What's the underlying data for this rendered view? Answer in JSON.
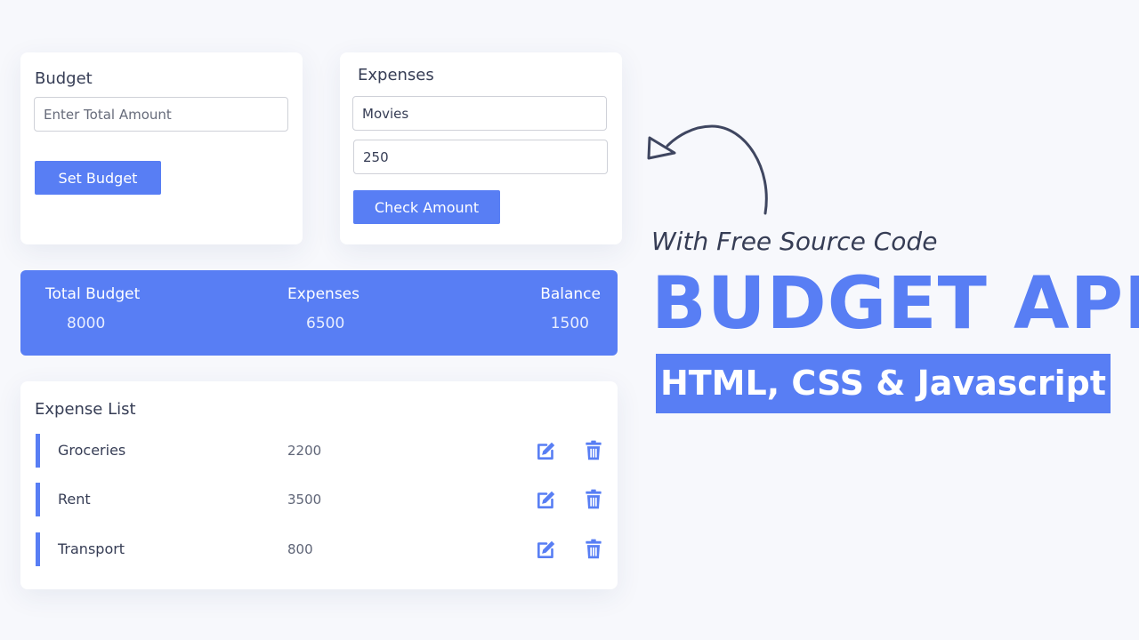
{
  "budget_card": {
    "title": "Budget",
    "amount_placeholder": "Enter Total Amount",
    "amount_value": "",
    "set_button_label": "Set Budget"
  },
  "expenses_card": {
    "title": "Expenses",
    "product_value": "Movies",
    "cost_value": "250",
    "check_button_label": "Check Amount"
  },
  "summary": {
    "total_budget_label": "Total Budget",
    "total_budget_value": "8000",
    "expenses_label": "Expenses",
    "expenses_value": "6500",
    "balance_label": "Balance",
    "balance_value": "1500"
  },
  "expense_list": {
    "title": "Expense List",
    "items": [
      {
        "name": "Groceries",
        "amount": "2200"
      },
      {
        "name": "Rent",
        "amount": "3500"
      },
      {
        "name": "Transport",
        "amount": "800"
      }
    ],
    "edit_icon": "edit-icon",
    "delete_icon": "trash-icon"
  },
  "hero": {
    "tagline": "With Free Source Code",
    "title": "BUDGET APP",
    "badge": "HTML, CSS & Javascript"
  },
  "colors": {
    "accent": "#587ef4",
    "text": "#363d55",
    "background": "#f7f8fc"
  }
}
